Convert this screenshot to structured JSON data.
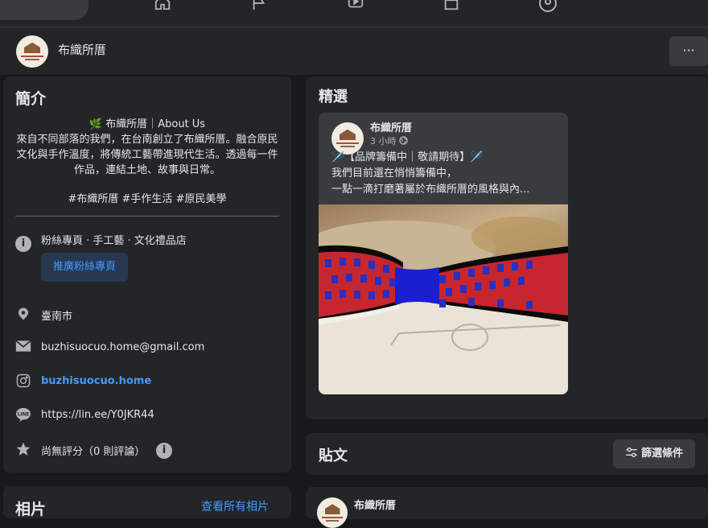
{
  "nav": {
    "icons": [
      "home-icon",
      "flag-icon",
      "video-icon",
      "marketplace-icon",
      "groups-icon"
    ]
  },
  "page": {
    "name": "布織所厝",
    "more_label": "···"
  },
  "intro": {
    "title": "簡介",
    "heading": "🌿 布織所厝｜About Us",
    "body": "來自不同部落的我們，在台南創立了布織所厝。融合原民文化與手作溫度，將傳統工藝帶進現代生活。透過每一件作品，連結土地、故事與日常。",
    "hashtags": "#布織所厝 #手作生活 #原民美學",
    "category": "粉絲專頁 · 手工藝 · 文化禮品店",
    "promote_label": "推廣粉絲專頁",
    "location": "臺南市",
    "email": "buzhisuocuo.home@gmail.com",
    "instagram": "buzhisuocuo.home",
    "line": "https://lin.ee/Y0JKR44",
    "rating": "尚無評分（0 則評論）",
    "info_glyph": "i"
  },
  "photos": {
    "title": "相片",
    "see_all": "查看所有相片"
  },
  "featured": {
    "title": "精選",
    "post": {
      "author": "布織所厝",
      "time": "3 小時",
      "line1": "🪡【品牌籌備中｜敬請期待】🪡",
      "line2": "我們目前還在悄悄籌備中，",
      "line3": "一點一滴打磨著屬於布織所厝的風格與內..."
    }
  },
  "posts": {
    "title": "貼文",
    "filter_label": "篩選條件",
    "first_author": "布織所厝"
  },
  "colors": {
    "background": "#18191a",
    "card": "#242526",
    "link": "#4599ff",
    "promote_bg": "#263951"
  }
}
